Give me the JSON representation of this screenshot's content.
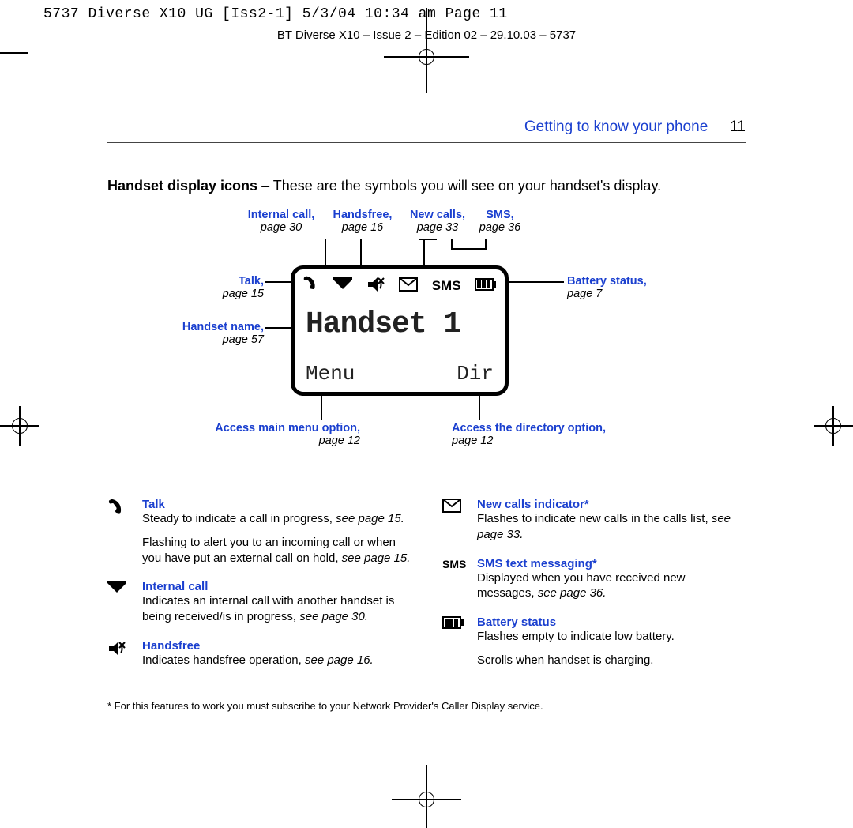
{
  "slug": "5737 Diverse X10 UG [Iss2-1]  5/3/04  10:34 am  Page 11",
  "doc_id": "BT Diverse X10 – Issue 2 – Edition 02 – 29.10.03 – 5737",
  "header": {
    "section": "Getting to know your phone",
    "page": "11"
  },
  "intro": {
    "bold": "Handset display icons",
    "rest": " – These are the symbols you will see on your handset's display."
  },
  "screen": {
    "name": "Handset 1",
    "softkey_left": "Menu",
    "softkey_right": "Dir",
    "sms_label": "SMS"
  },
  "callouts": {
    "internal_call": {
      "title": "Internal call,",
      "page": "page 30"
    },
    "handsfree": {
      "title": "Handsfree,",
      "page": "page 16"
    },
    "new_calls": {
      "title": "New calls,",
      "page": "page 33"
    },
    "sms": {
      "title": "SMS,",
      "page": "page 36"
    },
    "talk": {
      "title": "Talk,",
      "page": "page 15"
    },
    "handset_name": {
      "title": "Handset name,",
      "page": "page 57"
    },
    "battery": {
      "title": "Battery status,",
      "page": "page 7"
    },
    "menu": {
      "title": "Access main menu option,",
      "page": "page 12"
    },
    "dir": {
      "title": "Access the directory option,",
      "page": "page 12"
    }
  },
  "legend": {
    "talk": {
      "title": "Talk",
      "p1a": "Steady to indicate a call in progress, ",
      "p1b": "see page 15.",
      "p2a": "Flashing to alert you to an incoming call or when you have put an external call on hold, ",
      "p2b": "see page 15."
    },
    "internal": {
      "title": "Internal call",
      "p1a": "Indicates an internal call with another handset is being received/is in progress, ",
      "p1b": "see page 30."
    },
    "handsfree": {
      "title": "Handsfree",
      "p1a": "Indicates handsfree operation, ",
      "p1b": "see page 16."
    },
    "newcalls": {
      "title": "New calls indicator*",
      "p1a": "Flashes to indicate new calls in the calls list, ",
      "p1b": "see page 33."
    },
    "sms": {
      "title": "SMS text messaging*",
      "p1a": "Displayed when you have received new messages, ",
      "p1b": "see page 36.",
      "label": "SMS"
    },
    "battery": {
      "title": "Battery status",
      "p1": "Flashes empty to indicate low battery.",
      "p2": "Scrolls when handset is charging."
    }
  },
  "footnote": "*  For this features to work you must subscribe to your Network Provider's Caller Display service."
}
